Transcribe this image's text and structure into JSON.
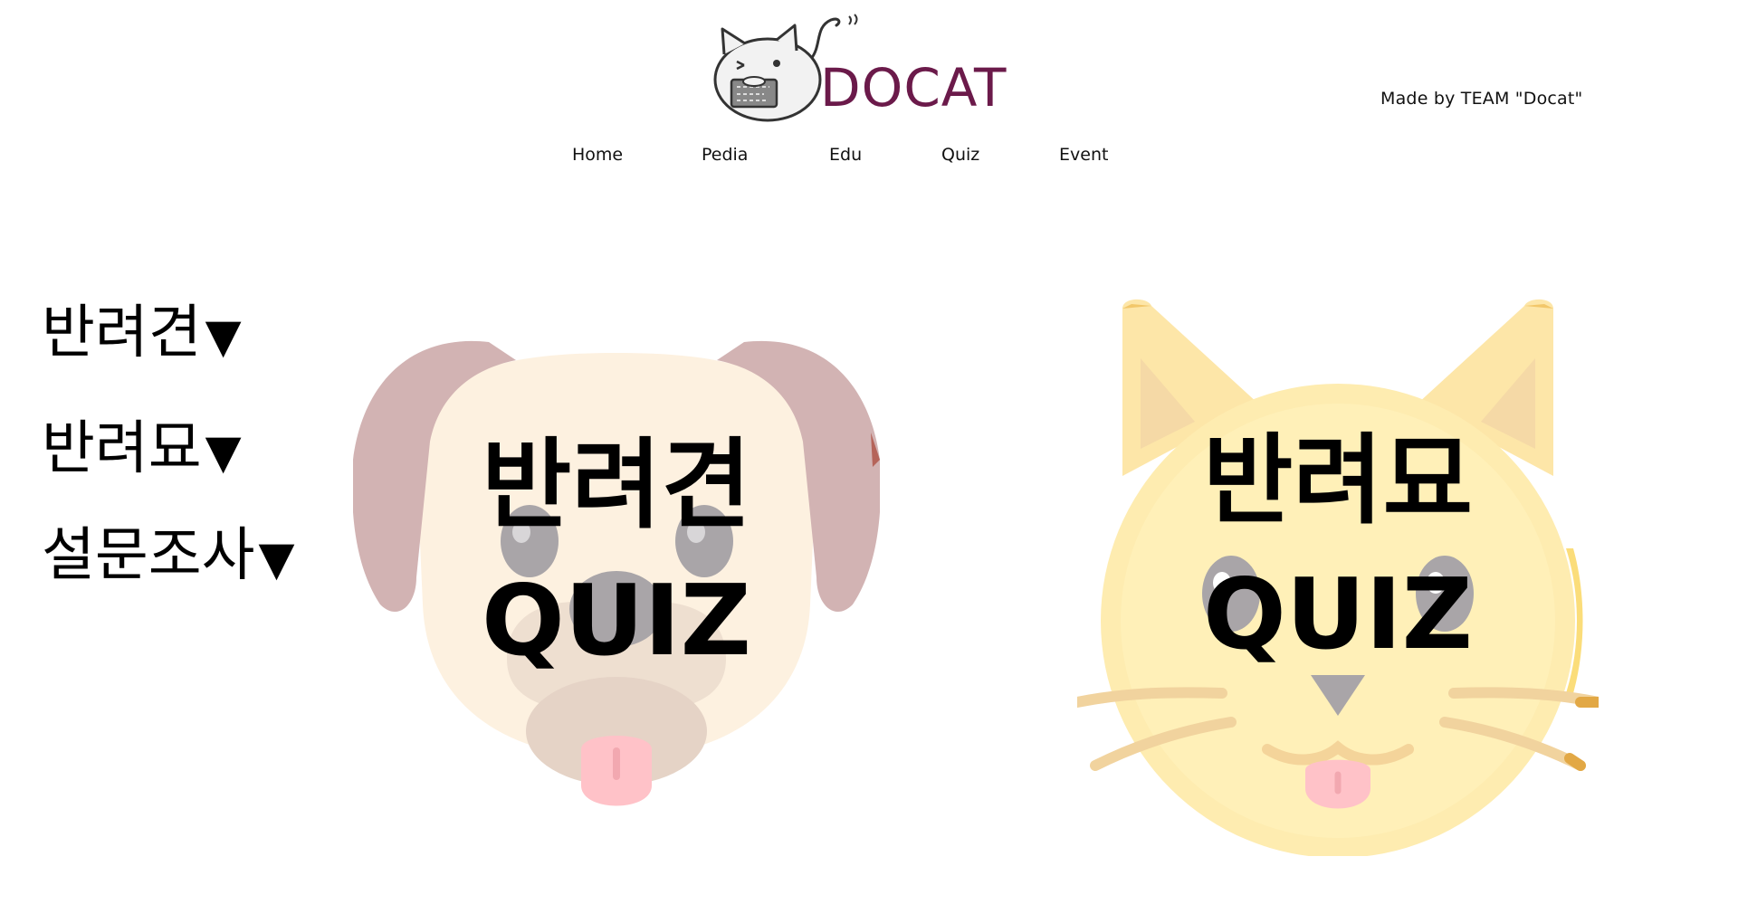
{
  "header": {
    "logo_text": "DOCAT",
    "credit": "Made by TEAM \"Docat\""
  },
  "nav": {
    "items": [
      {
        "label": "Home"
      },
      {
        "label": "Pedia"
      },
      {
        "label": "Edu"
      },
      {
        "label": "Quiz"
      },
      {
        "label": "Event"
      }
    ]
  },
  "side_menu": {
    "items": [
      {
        "label": "반려견",
        "arrow": "▼"
      },
      {
        "label": "반려묘",
        "arrow": "▼"
      },
      {
        "label": "설문조사",
        "arrow": "▼"
      }
    ]
  },
  "quiz_cards": {
    "dog": {
      "title": "반려견",
      "subtitle": "QUIZ",
      "icon": "dog-face-icon"
    },
    "cat": {
      "title": "반려묘",
      "subtitle": "QUIZ",
      "icon": "cat-face-icon"
    }
  },
  "colors": {
    "logo_text": "#6b1a4a",
    "dog_ear": "#c9a6a6",
    "dog_face": "#fdf0df",
    "cat_face": "#fde9a6",
    "tongue": "#ffc2c8"
  }
}
